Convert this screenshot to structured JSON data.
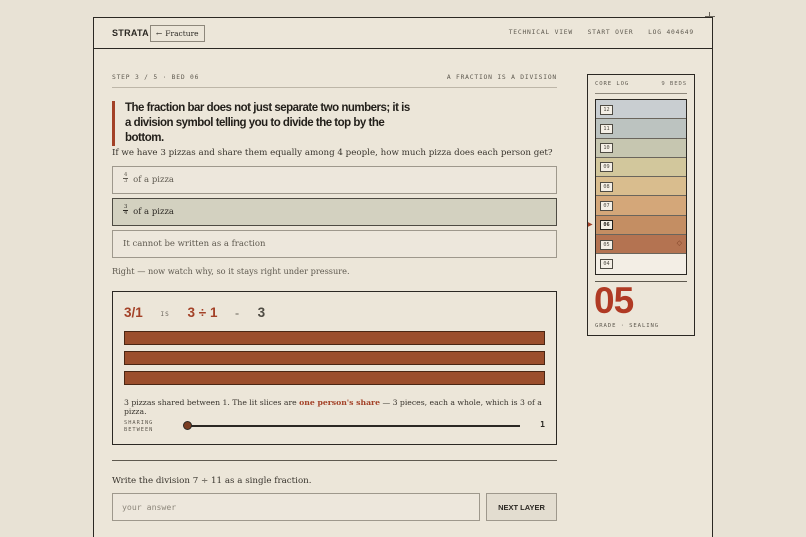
{
  "header": {
    "brand": "STRATA",
    "crumb_arrow": "←",
    "crumb_label": "Fracture",
    "nav": [
      "TECHNICAL VIEW",
      "START OVER",
      "LOG 404649"
    ]
  },
  "step": {
    "left": "STEP 3 / 5 · BED 06",
    "right": "A FRACTION IS A DIVISION"
  },
  "callout": "The fraction bar does not just separate two numbers; it is a division symbol telling you to divide the top by the bottom.",
  "question": "If we have 3 pizzas and share them equally among 4 people, how much pizza does each person get?",
  "options": [
    {
      "numerator": "4",
      "denominator": "3",
      "text": "of a pizza",
      "selected": false
    },
    {
      "numerator": "3",
      "denominator": "4",
      "text": "of a pizza",
      "selected": true
    },
    {
      "text": "It cannot be written as a fraction",
      "selected": false
    }
  ],
  "feedback": "Right — now watch why, so it stays right under pressure.",
  "demo": {
    "fraction": "3/1",
    "is_word": "IS",
    "division": "3 ÷ 1",
    "equals": "=",
    "result": "3",
    "bars_count": 3,
    "bar_color": "#9b4e2c",
    "explain_pre": "3 pizzas shared between 1. The lit slices are",
    "explain_hl": "one person's share",
    "explain_post": "— 3 pieces, each a whole, which is 3 of a pizza.",
    "slider_label_1": "SHARING",
    "slider_label_2": "BETWEEN",
    "slider_value": "1",
    "slider_fraction": 0
  },
  "task": {
    "prompt": "Write the division 7 ÷ 11 as a single fraction.",
    "placeholder": "your answer",
    "button": "NEXT LAYER"
  },
  "core_log": {
    "title": "CORE LOG",
    "count": "9 BEDS",
    "current_marker": "▶",
    "sealed_mark": "◇",
    "layers": [
      {
        "num": "12",
        "color": "#c9ced1",
        "state": "upper"
      },
      {
        "num": "11",
        "color": "#bcc3c0",
        "state": "upper"
      },
      {
        "num": "10",
        "color": "#c6c6b0",
        "state": "upper"
      },
      {
        "num": "09",
        "color": "#d2c79c",
        "state": "upper"
      },
      {
        "num": "08",
        "color": "#d9bd8e",
        "state": "upper"
      },
      {
        "num": "07",
        "color": "#d4a779",
        "state": "upper"
      },
      {
        "num": "06",
        "color": "#c48e63",
        "state": "current"
      },
      {
        "num": "05",
        "color": "#b47351",
        "state": "sealed"
      },
      {
        "num": "04",
        "color": "#f3eee5",
        "state": "empty"
      }
    ],
    "grade": "05",
    "grade_label": "GRADE · SEALING",
    "grade_color": "#b03a24"
  }
}
